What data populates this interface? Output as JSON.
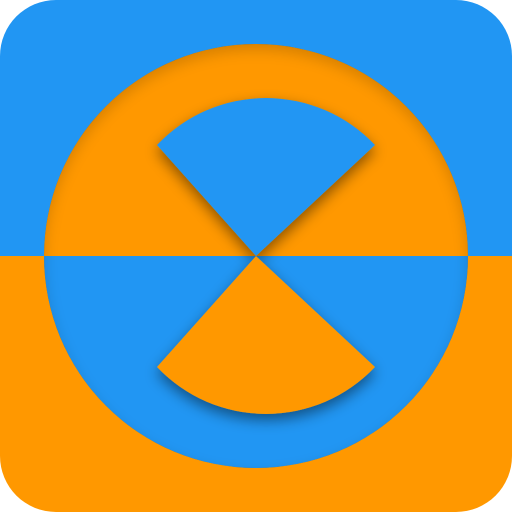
{
  "app_icon": {
    "icon_name": "split-circle-hourglass-icon",
    "colors": {
      "blue": "#2196F3",
      "orange": "#FF9800",
      "shadow": "#000000"
    }
  }
}
